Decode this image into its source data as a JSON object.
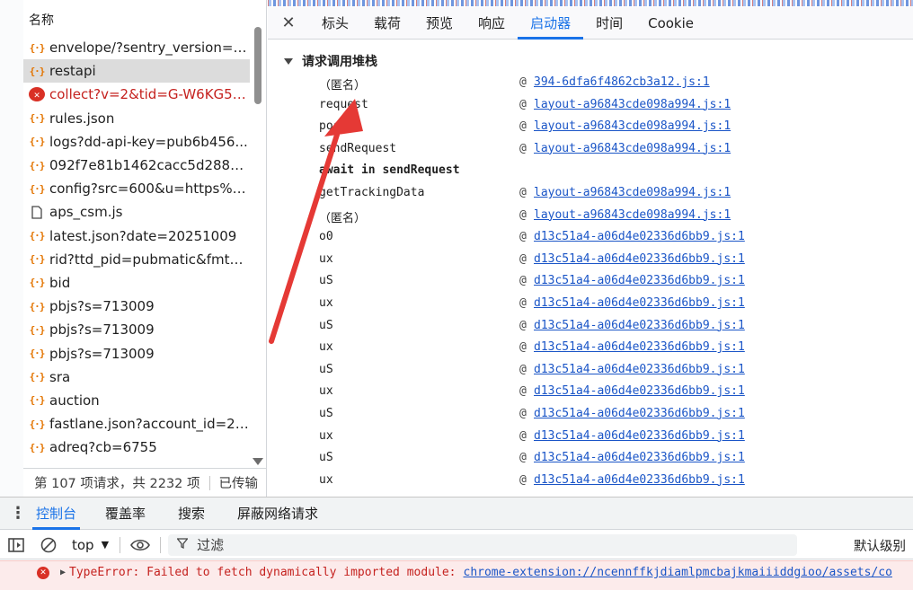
{
  "requests_panel": {
    "header": "名称",
    "items": [
      {
        "name": "envelope/?sentry_version=7...",
        "icon": "fetch",
        "state": "normal"
      },
      {
        "name": "restapi",
        "icon": "fetch",
        "state": "selected"
      },
      {
        "name": "collect?v=2&tid=G-W6KG51...",
        "icon": "error",
        "state": "error"
      },
      {
        "name": "rules.json",
        "icon": "fetch",
        "state": "normal"
      },
      {
        "name": "logs?dd-api-key=pub6b456...",
        "icon": "fetch",
        "state": "normal"
      },
      {
        "name": "092f7e81b1462cacc5d28877...",
        "icon": "fetch",
        "state": "normal"
      },
      {
        "name": "config?src=600&u=https%3...",
        "icon": "fetch",
        "state": "normal"
      },
      {
        "name": "aps_csm.js",
        "icon": "document",
        "state": "normal"
      },
      {
        "name": "latest.json?date=20251009",
        "icon": "fetch",
        "state": "normal"
      },
      {
        "name": "rid?ttd_pid=pubmatic&fmt=...",
        "icon": "fetch",
        "state": "normal"
      },
      {
        "name": "bid",
        "icon": "fetch",
        "state": "normal"
      },
      {
        "name": "pbjs?s=713009",
        "icon": "fetch",
        "state": "normal"
      },
      {
        "name": "pbjs?s=713009",
        "icon": "fetch",
        "state": "normal"
      },
      {
        "name": "pbjs?s=713009",
        "icon": "fetch",
        "state": "normal"
      },
      {
        "name": "sra",
        "icon": "fetch",
        "state": "normal"
      },
      {
        "name": "auction",
        "icon": "fetch",
        "state": "normal"
      },
      {
        "name": "fastlane.json?account_id=20...",
        "icon": "fetch",
        "state": "normal"
      },
      {
        "name": "adreq?cb=6755",
        "icon": "fetch",
        "state": "normal"
      }
    ],
    "status": {
      "count_text": "第 107 项请求，共 2232 项",
      "transfer_text": "已传输"
    }
  },
  "detail_tabs": {
    "close_symbol": "✕",
    "tabs": [
      "标头",
      "载荷",
      "预览",
      "响应",
      "启动器",
      "时间",
      "Cookie"
    ],
    "active": "启动器"
  },
  "initiator": {
    "section_title": "请求调用堆栈",
    "frames": [
      {
        "fn": "（匿名）",
        "at": "@",
        "loc": "394-6dfa6f4862cb3a12.js:1",
        "async": false
      },
      {
        "fn": "request",
        "at": "@",
        "loc": "layout-a96843cde098a994.js:1",
        "async": false
      },
      {
        "fn": "post",
        "at": "@",
        "loc": "layout-a96843cde098a994.js:1",
        "async": false
      },
      {
        "fn": "sendRequest",
        "at": "@",
        "loc": "layout-a96843cde098a994.js:1",
        "async": false
      },
      {
        "fn": "await in sendRequest",
        "at": "",
        "loc": "",
        "async": true
      },
      {
        "fn": "getTrackingData",
        "at": "@",
        "loc": "layout-a96843cde098a994.js:1",
        "async": false
      },
      {
        "fn": "（匿名）",
        "at": "@",
        "loc": "layout-a96843cde098a994.js:1",
        "async": false
      },
      {
        "fn": "o0",
        "at": "@",
        "loc": "d13c51a4-a06d4e02336d6bb9.js:1",
        "async": false
      },
      {
        "fn": "ux",
        "at": "@",
        "loc": "d13c51a4-a06d4e02336d6bb9.js:1",
        "async": false
      },
      {
        "fn": "uS",
        "at": "@",
        "loc": "d13c51a4-a06d4e02336d6bb9.js:1",
        "async": false
      },
      {
        "fn": "ux",
        "at": "@",
        "loc": "d13c51a4-a06d4e02336d6bb9.js:1",
        "async": false
      },
      {
        "fn": "uS",
        "at": "@",
        "loc": "d13c51a4-a06d4e02336d6bb9.js:1",
        "async": false
      },
      {
        "fn": "ux",
        "at": "@",
        "loc": "d13c51a4-a06d4e02336d6bb9.js:1",
        "async": false
      },
      {
        "fn": "uS",
        "at": "@",
        "loc": "d13c51a4-a06d4e02336d6bb9.js:1",
        "async": false
      },
      {
        "fn": "ux",
        "at": "@",
        "loc": "d13c51a4-a06d4e02336d6bb9.js:1",
        "async": false
      },
      {
        "fn": "uS",
        "at": "@",
        "loc": "d13c51a4-a06d4e02336d6bb9.js:1",
        "async": false
      },
      {
        "fn": "ux",
        "at": "@",
        "loc": "d13c51a4-a06d4e02336d6bb9.js:1",
        "async": false
      },
      {
        "fn": "uS",
        "at": "@",
        "loc": "d13c51a4-a06d4e02336d6bb9.js:1",
        "async": false
      },
      {
        "fn": "ux",
        "at": "@",
        "loc": "d13c51a4-a06d4e02336d6bb9.js:1",
        "async": false
      }
    ]
  },
  "annotation": {
    "arrow_color": "#e53935",
    "points_to": "request"
  },
  "drawer": {
    "menu_symbol": "⋮",
    "tabs": [
      "控制台",
      "覆盖率",
      "搜索",
      "屏蔽网络请求"
    ],
    "active": "控制台",
    "toolbar": {
      "context": "top",
      "filter_placeholder": "过滤",
      "levels": "默认级别"
    },
    "message": {
      "type": "error",
      "text": "TypeError: Failed to fetch dynamically imported module:",
      "link": "chrome-extension://ncennffkjdiamlpmcbajkmaiiiddgioo/assets/co"
    }
  },
  "colors": {
    "accent": "#1a73e8",
    "error": "#d93025",
    "link": "#1a55c7",
    "selected_row": "#dcdcdc"
  }
}
